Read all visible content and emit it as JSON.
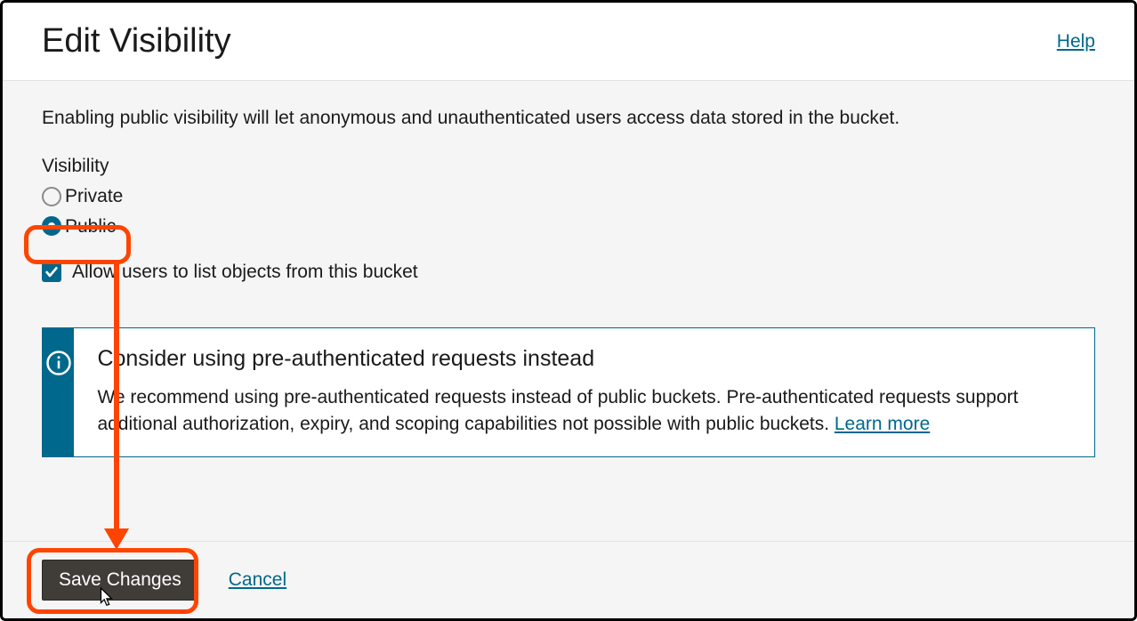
{
  "header": {
    "title": "Edit Visibility",
    "help": "Help"
  },
  "body": {
    "intro": "Enabling public visibility will let anonymous and unauthenticated users access data stored in the bucket.",
    "group_label": "Visibility",
    "options": {
      "private": "Private",
      "public": "Public",
      "selected": "public"
    },
    "list_objects_label": "Allow users to list objects from this bucket",
    "list_objects_checked": true
  },
  "info": {
    "title": "Consider using pre-authenticated requests instead",
    "text": "We recommend using pre-authenticated requests instead of public buckets. Pre-authenticated requests support additional authorization, expiry, and scoping capabilities not possible with public buckets. ",
    "learn_more": "Learn more"
  },
  "footer": {
    "save": "Save Changes",
    "cancel": "Cancel"
  }
}
